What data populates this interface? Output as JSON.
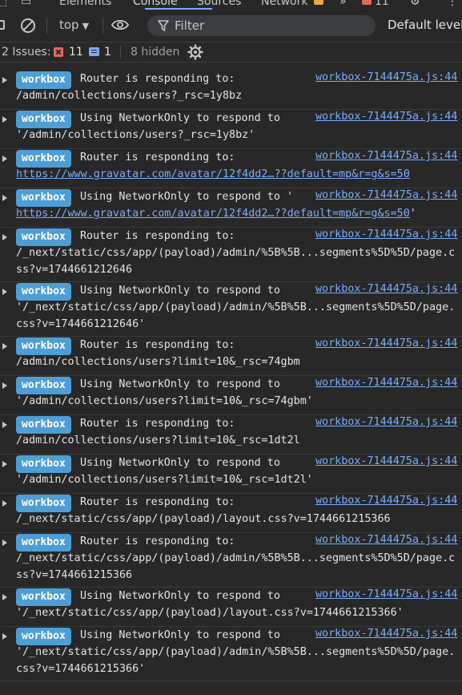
{
  "tabs": {
    "elements": "Elements",
    "console": "Console",
    "sources": "Sources",
    "network": "Network",
    "more": "»",
    "error_count": "11"
  },
  "toolbar": {
    "context": "top",
    "filter_placeholder": "Filter",
    "levels": "Default levels"
  },
  "issues": {
    "label": "2 Issues:",
    "errors": "11",
    "info": "1",
    "hidden": "8 hidden"
  },
  "entries": [
    {
      "badge": "workbox",
      "l1": "Router is responding to:",
      "l2": "/admin/collections/users?_rsc=1y8bz",
      "src": "workbox-7144475a.js:44"
    },
    {
      "badge": "workbox",
      "l1": "Using NetworkOnly to respond to",
      "l2": "'/admin/collections/users?_rsc=1y8bz'",
      "src": "workbox-7144475a.js:44"
    },
    {
      "badge": "workbox",
      "l1": "Router is responding to:",
      "l2_link": "https://www.gravatar.com/avatar/12f4dd2…??default=mp&r=g&s=50",
      "src": "workbox-7144475a.js:44"
    },
    {
      "badge": "workbox",
      "l1": "Using NetworkOnly to respond to '",
      "l2_link": "https://www.gravatar.com/avatar/12f4dd2…??default=mp&r=g&s=50",
      "l2_suffix": "'",
      "src": "workbox-7144475a.js:44"
    },
    {
      "badge": "workbox",
      "l1": "Router is responding to:",
      "l2": "/_next/static/css/app/(payload)/admin/%5B%5B...segments%5D%5D/page.c",
      "l3": "ss?v=1744661212646",
      "src": "workbox-7144475a.js:44"
    },
    {
      "badge": "workbox",
      "l1": "Using NetworkOnly to respond to",
      "l2": "'/_next/static/css/app/(payload)/admin/%5B%5B...segments%5D%5D/page.",
      "l3": "css?v=1744661212646'",
      "src": "workbox-7144475a.js:44"
    },
    {
      "badge": "workbox",
      "l1": "Router is responding to:",
      "l2": "/admin/collections/users?limit=10&_rsc=74gbm",
      "src": "workbox-7144475a.js:44"
    },
    {
      "badge": "workbox",
      "l1": "Using NetworkOnly to respond to",
      "l2": "'/admin/collections/users?limit=10&_rsc=74gbm'",
      "src": "workbox-7144475a.js:44"
    },
    {
      "badge": "workbox",
      "l1": "Router is responding to:",
      "l2": "/admin/collections/users?limit=10&_rsc=1dt2l",
      "src": "workbox-7144475a.js:44"
    },
    {
      "badge": "workbox",
      "l1": "Using NetworkOnly to respond to",
      "l2": "'/admin/collections/users?limit=10&_rsc=1dt2l'",
      "src": "workbox-7144475a.js:44"
    },
    {
      "badge": "workbox",
      "l1": "Router is responding to:",
      "l2": "/_next/static/css/app/(payload)/layout.css?v=1744661215366",
      "src": "workbox-7144475a.js:44"
    },
    {
      "badge": "workbox",
      "l1": "Router is responding to:",
      "l2": "/_next/static/css/app/(payload)/admin/%5B%5B...segments%5D%5D/page.c",
      "l3": "ss?v=1744661215366",
      "src": "workbox-7144475a.js:44"
    },
    {
      "badge": "workbox",
      "l1": "Using NetworkOnly to respond to",
      "l2": "'/_next/static/css/app/(payload)/layout.css?v=1744661215366'",
      "src": "workbox-7144475a.js:44"
    },
    {
      "badge": "workbox",
      "l1": "Using NetworkOnly to respond to",
      "l2": "'/_next/static/css/app/(payload)/admin/%5B%5B...segments%5D%5D/page.",
      "l3": "css?v=1744661215366'",
      "src": "workbox-7144475a.js:44"
    }
  ]
}
